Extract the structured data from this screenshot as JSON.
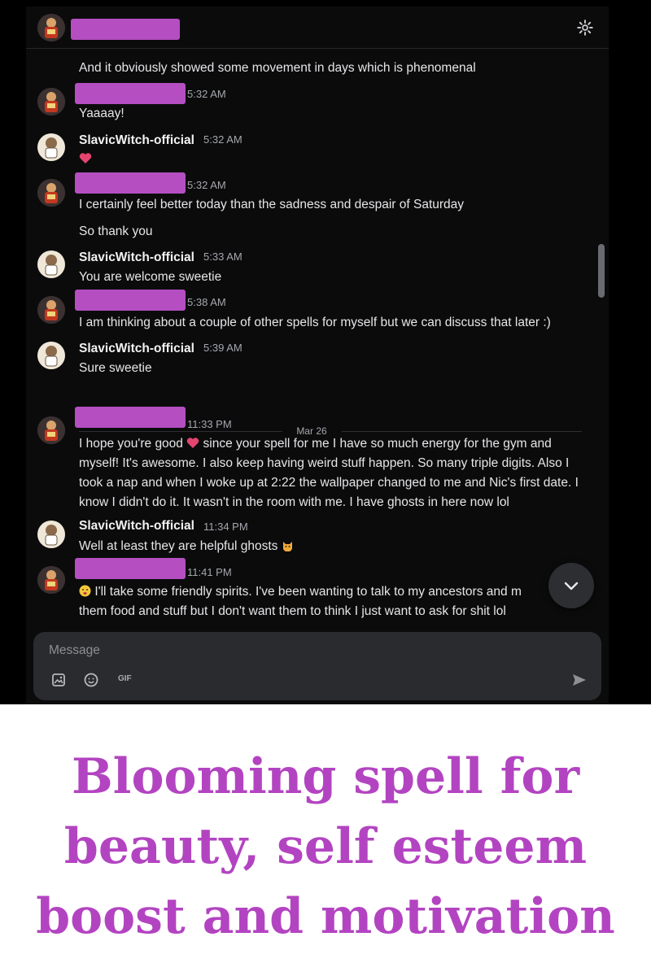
{
  "chat": {
    "previous_text": "And it obviously showed some movement in days which is phenomenal",
    "messages": [
      {
        "author": "",
        "time": "5:32 AM",
        "lines": [
          "Yaaaay!"
        ]
      },
      {
        "author": "SlavicWitch-official",
        "time": "5:32 AM",
        "emoji": "heart"
      },
      {
        "author": "",
        "time": "5:32 AM",
        "lines": [
          "I certainly feel better today than the sadness and despair of Saturday",
          "So thank you"
        ]
      },
      {
        "author": "SlavicWitch-official",
        "time": "5:33 AM",
        "lines": [
          "You are welcome sweetie"
        ]
      },
      {
        "author": "",
        "time": "5:38 AM",
        "lines": [
          "I am thinking about a couple of other spells for myself but we can discuss that later :)"
        ]
      },
      {
        "author": "SlavicWitch-official",
        "time": "5:39 AM",
        "lines": [
          "Sure sweetie"
        ]
      },
      {
        "author": "",
        "time": "11:33 PM",
        "lines": [
          "I hope you're good",
          "since your spell for me I have so much energy for the gym and myself! It's awesome. I also keep having weird stuff happen. So many triple digits. Also I took a nap and when I woke up at 2:22 the wallpaper changed to me and Nic's first date. I know I didn't do it. It wasn't in the room with me. I have ghosts in here now lol"
        ]
      },
      {
        "author": "SlavicWitch-official",
        "time": "11:34 PM",
        "lines": [
          "Well at least they are helpful ghosts"
        ]
      },
      {
        "author": "",
        "time": "11:41 PM",
        "lines": [
          "I'll take some friendly spirits. I've been wanting to talk to my ancestors and m",
          "them food and stuff but I don't want them to think I just want to ask for shit lol"
        ]
      }
    ],
    "date_divider": "Mar 26"
  },
  "composer": {
    "placeholder": "Message",
    "gif_label": "GIF"
  },
  "icons": {
    "settings": "gear-icon",
    "jump": "chevron-down-icon",
    "image": "image-icon",
    "emoji": "smiley-icon",
    "send": "send-icon"
  },
  "colors": {
    "redaction": "#b44ec1",
    "caption": "#b344c1",
    "heart": "#e3456f"
  },
  "caption": {
    "line1": "Blooming spell for",
    "line2": "beauty, self esteem",
    "line3": "boost and motivation"
  }
}
